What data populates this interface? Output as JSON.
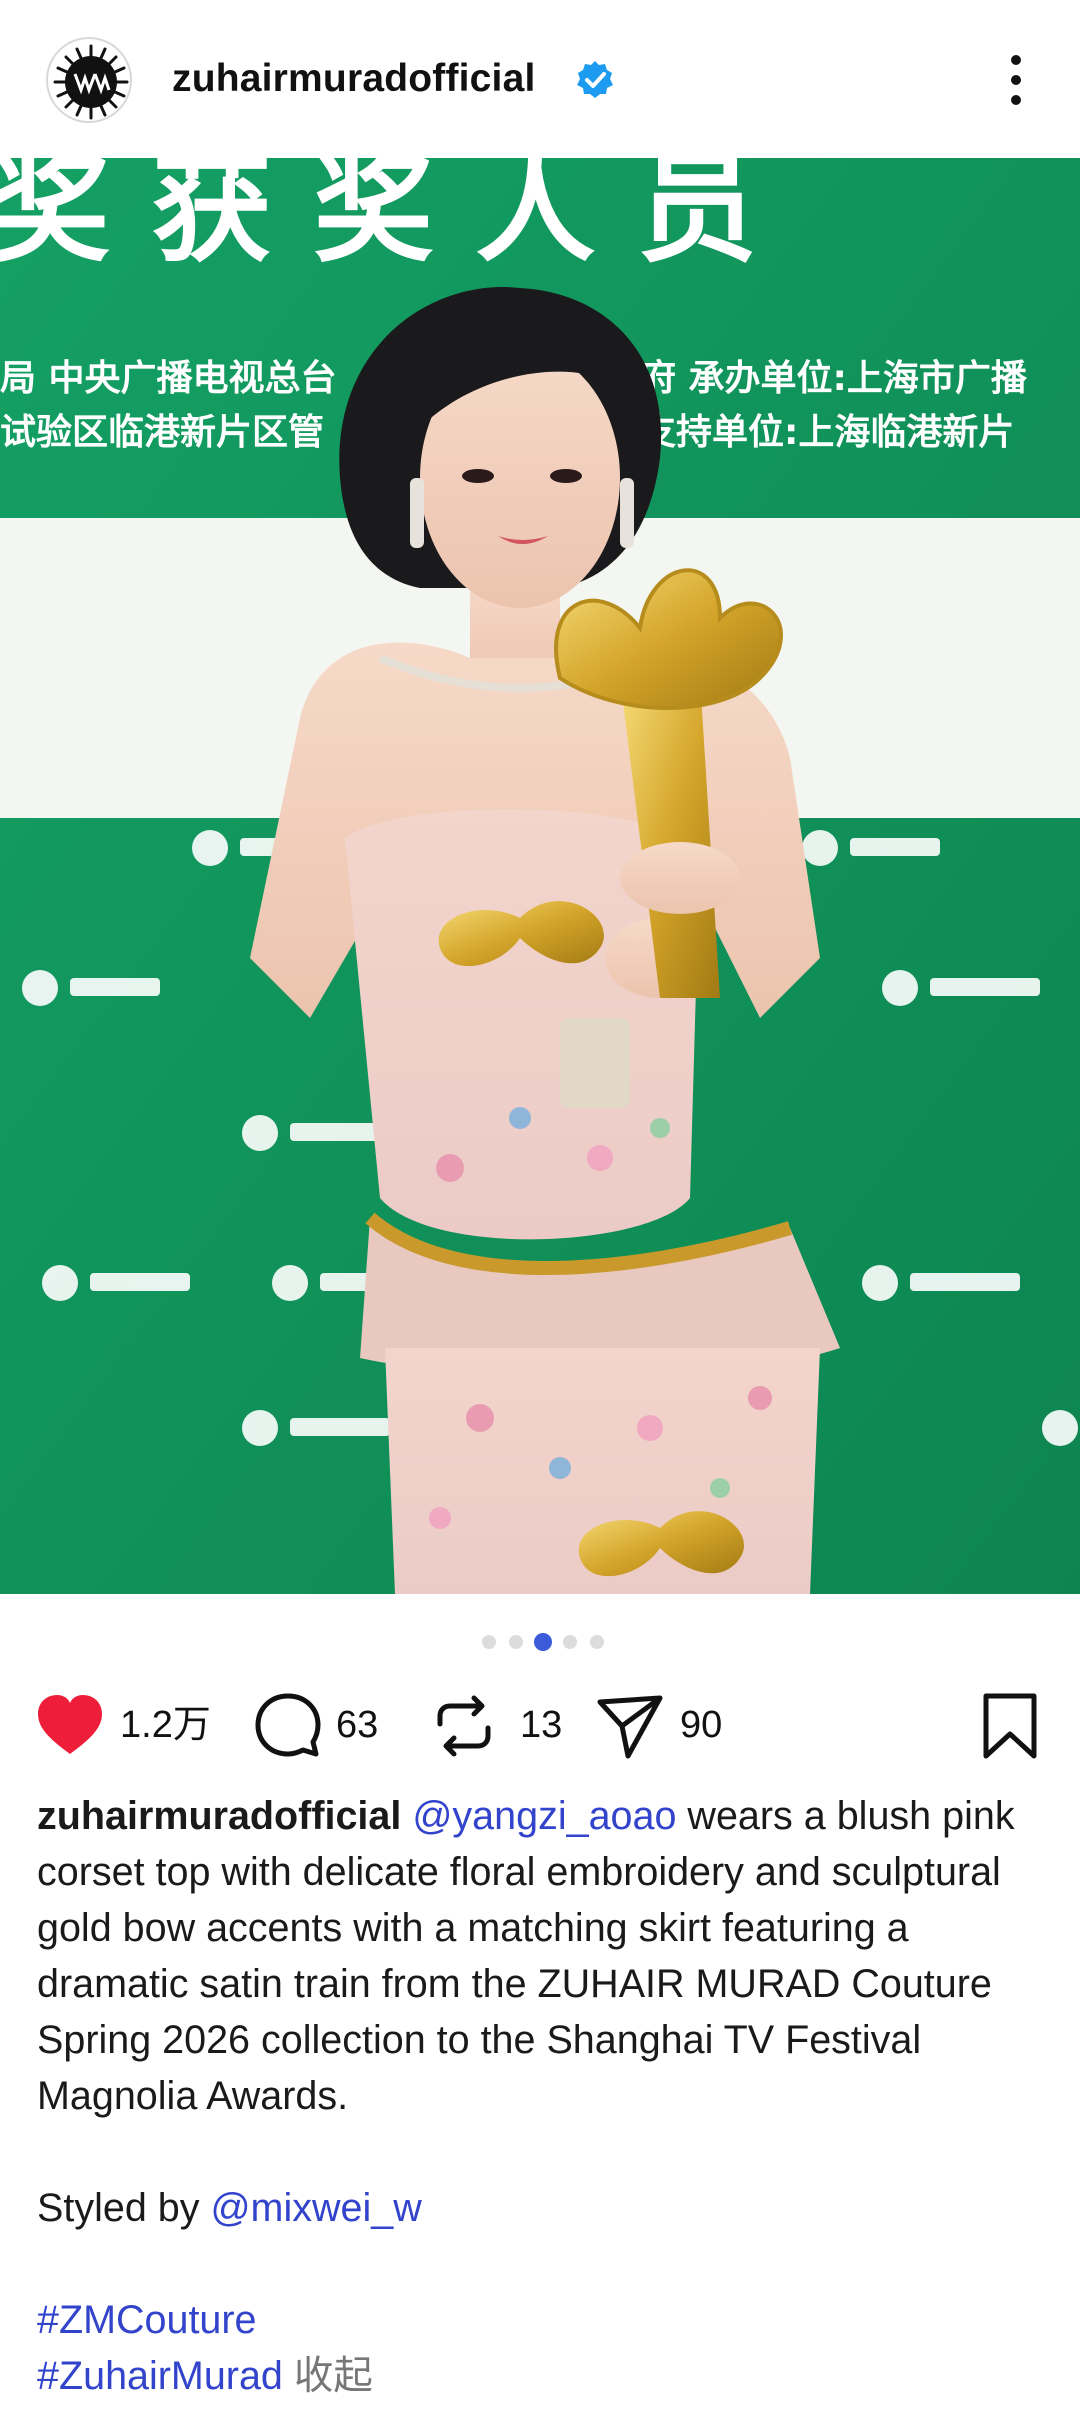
{
  "header": {
    "username": "zuhairmuradofficial",
    "verified": true,
    "avatar_icon": "zm-logo-icon",
    "more_icon": "more-vertical-icon"
  },
  "photo": {
    "backdrop_text_top": "奖 获 奖 人 员",
    "backdrop_line1_left": "局 中央广播电视总台",
    "backdrop_line1_right": "府 承办单位:上海市广播",
    "backdrop_line2_left": "试验区临港新片区管",
    "backdrop_line2_right": "支持单位:上海临港新片"
  },
  "carousel": {
    "count": 5,
    "active_index": 2
  },
  "actions": {
    "like_count": "1.2万",
    "comment_count": "63",
    "repost_count": "13",
    "share_count": "90"
  },
  "caption": {
    "username": "zuhairmuradofficial",
    "mention1": "@yangzi_aoao",
    "text1": " wears a blush pink corset top with delicate floral embroidery and sculptural gold bow accents with a matching skirt featuring a dramatic satin train from the ZUHAIR MURAD Couture Spring 2026 collection to the Shanghai TV Festival Magnolia Awards.",
    "styled_by": "Styled by ",
    "mention2": "@mixwei_w",
    "hashtag1": "#ZMCouture",
    "hashtag2": "#ZuhairMurad",
    "collapse": " 收起"
  },
  "colors": {
    "like": "#ee1d3a",
    "link": "#3344cc",
    "verified": "#1d9bf0",
    "backdrop_green": "#12925a",
    "dot_active": "#3b5bdb"
  }
}
